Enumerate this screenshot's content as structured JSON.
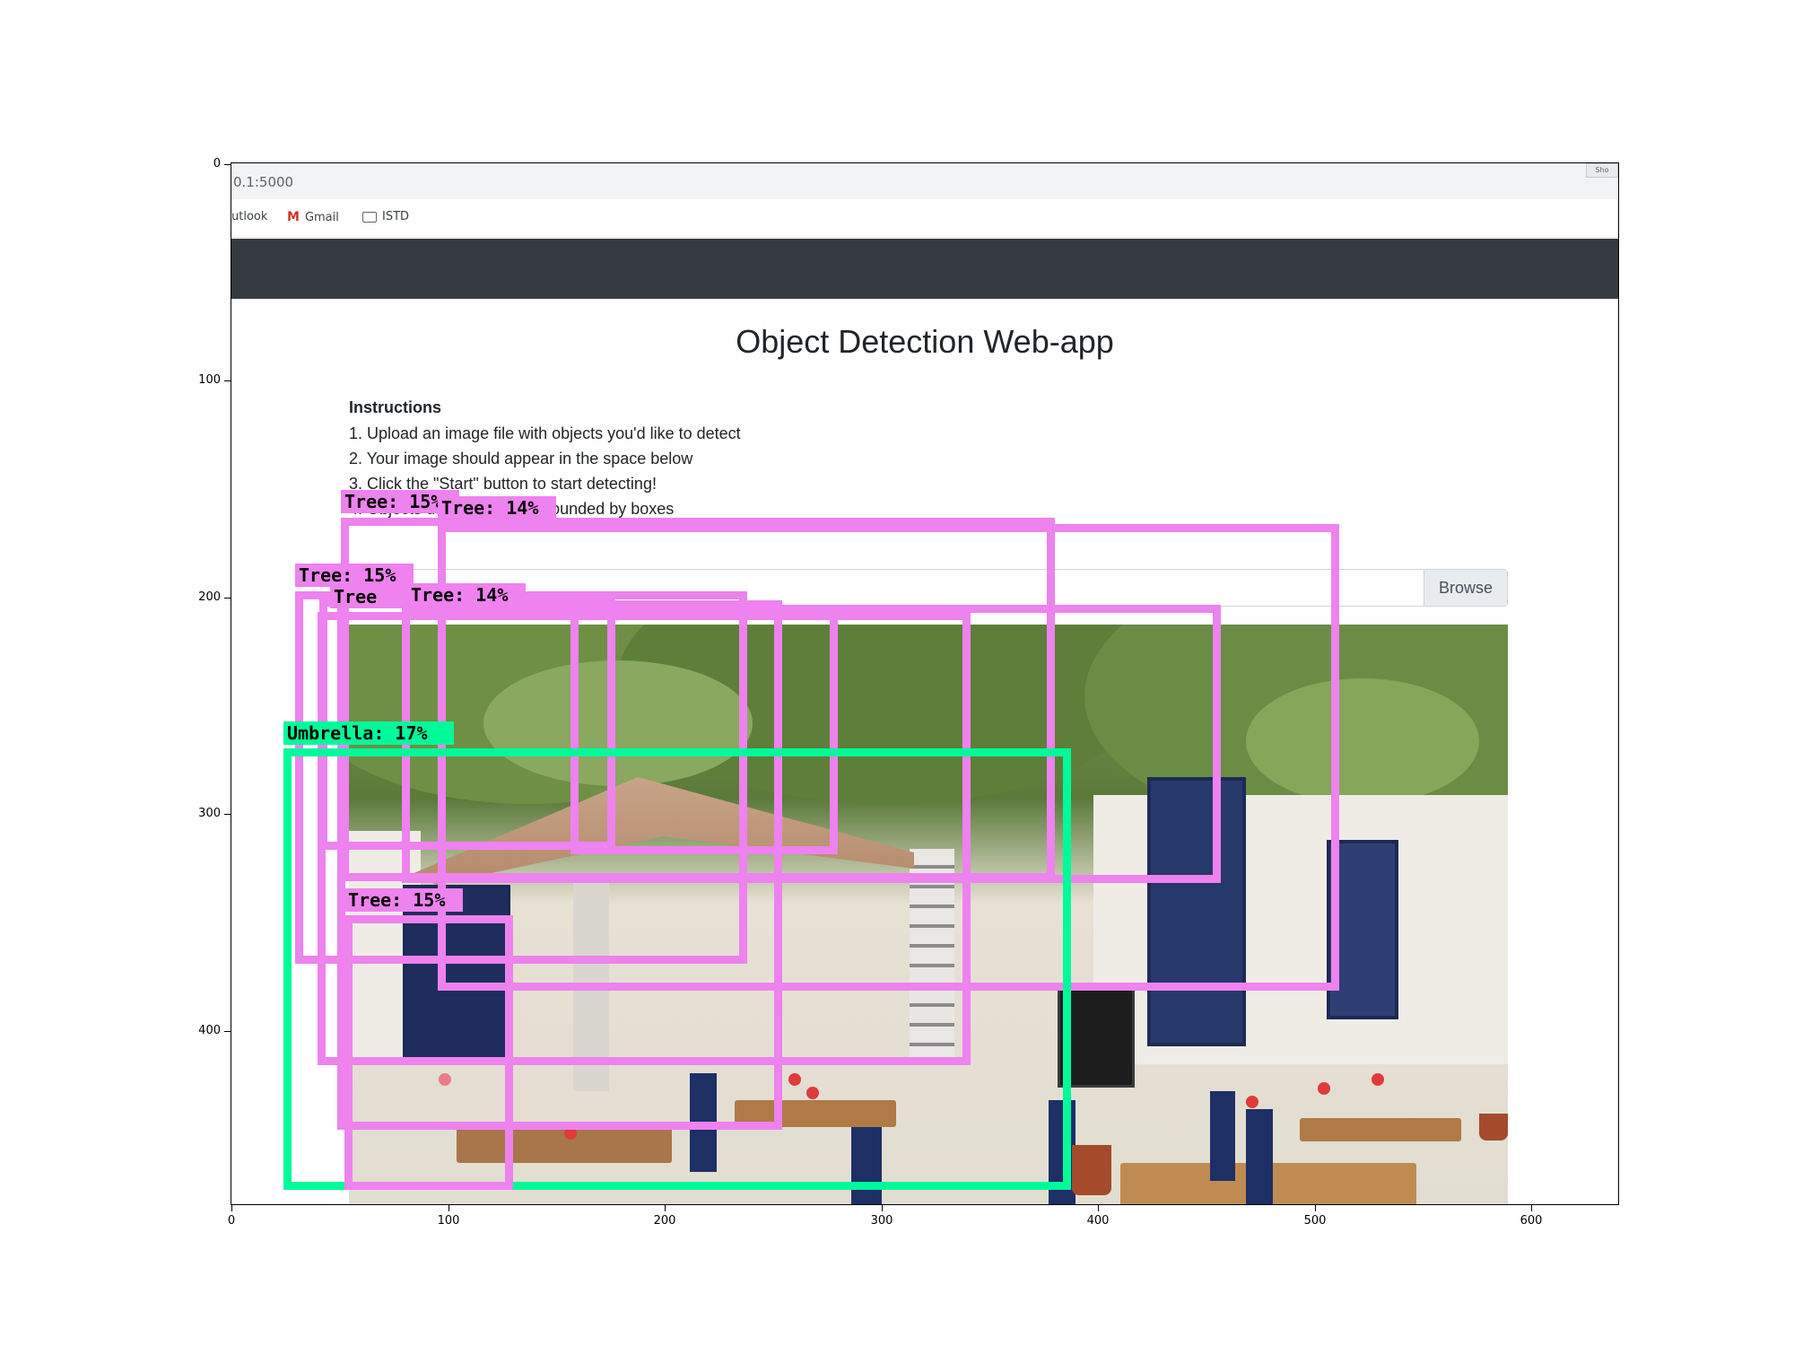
{
  "figure": {
    "x_ticks": [
      "0",
      "100",
      "200",
      "300",
      "400",
      "500",
      "600"
    ],
    "y_ticks": [
      "0",
      "100",
      "200",
      "300",
      "400"
    ]
  },
  "browser": {
    "url": "0.1:5000",
    "corner_label": "Sho",
    "bookmarks": [
      {
        "label": "utlook",
        "icon": "none"
      },
      {
        "label": "Gmail",
        "icon": "gmail-icon"
      },
      {
        "label": "ISTD",
        "icon": "folder-icon"
      }
    ]
  },
  "app": {
    "title": "Object Detection Web-app",
    "instructions_heading": "Instructions",
    "steps": [
      "1. Upload an image file with objects you'd like to detect",
      "2. Your image should appear in the space below",
      "3. Click the \"Start\" button to start detecting!",
      "4. Objects detected will be bounded by boxes"
    ],
    "browse_label": "Browse"
  },
  "detections": [
    {
      "name": "tree-label-1",
      "label": "Tree: 15%",
      "cls": "tree"
    },
    {
      "name": "tree-label-2",
      "label": "Tree: 14%",
      "cls": "tree"
    },
    {
      "name": "tree-label-3",
      "label": "Tree: 15%",
      "cls": "tree"
    },
    {
      "name": "tree-label-4",
      "label": "Tree",
      "cls": "tree"
    },
    {
      "name": "tree-label-5",
      "label": "Tree: 14%",
      "cls": "tree"
    },
    {
      "name": "umbrella-label",
      "label": "Umbrella: 17%",
      "cls": "umbrella"
    },
    {
      "name": "tree-label-6",
      "label": "Tree: 15%",
      "cls": "tree"
    }
  ],
  "colors": {
    "tree": "#ee82ee",
    "umbrella": "#00fa9a"
  }
}
